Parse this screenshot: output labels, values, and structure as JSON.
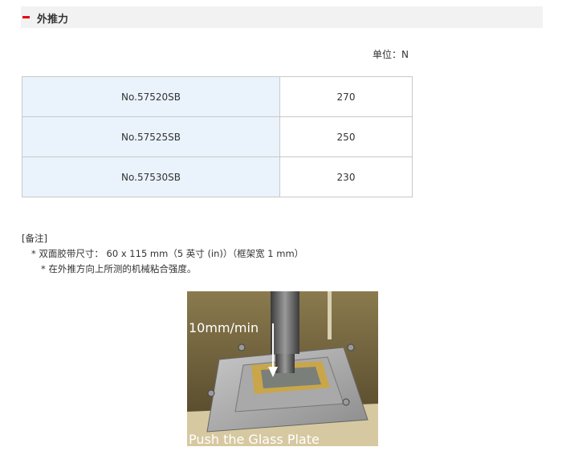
{
  "section": {
    "title": "外推力"
  },
  "unit_label": "单位：N",
  "table": {
    "rows": [
      {
        "model": "No.57520SB",
        "value": "270"
      },
      {
        "model": "No.57525SB",
        "value": "250"
      },
      {
        "model": "No.57530SB",
        "value": "230"
      }
    ]
  },
  "notes": {
    "heading": "[备注]",
    "line1": "* 双面胶带尺寸： 60 x 115 mm（5 英寸 (in)）（框架宽 1 mm）",
    "line2": "* 在外推方向上所测的机械粘合强度。"
  },
  "photo": {
    "speed_label": "10mm/min",
    "caption": "Push the Glass Plate"
  },
  "colors": {
    "accent": "#e60012",
    "model_cell_bg": "#eaf3fc",
    "header_bg": "#f2f2f2"
  }
}
